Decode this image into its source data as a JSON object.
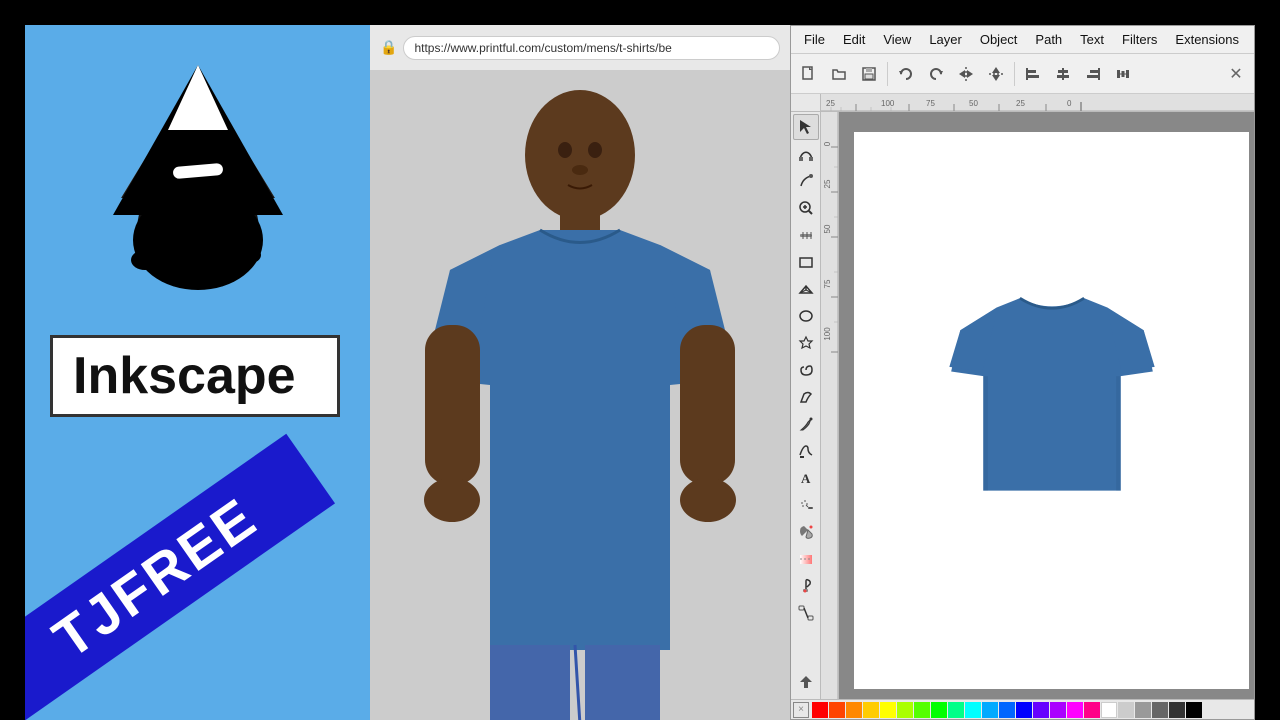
{
  "left_panel": {
    "bg_color": "#5aace8",
    "logo_alt": "Inkscape mountain logo",
    "title": "Inkscape",
    "banner_text": "TJFREE",
    "banner_bg": "#1a1acc"
  },
  "browser": {
    "url": "https://www.printful.com/custom/mens/t-shirts/be",
    "lock_icon": "🔒"
  },
  "inkscape_app": {
    "menu_items": [
      "File",
      "Edit",
      "View",
      "Layer",
      "Object",
      "Path",
      "Text",
      "Filters",
      "Extensions"
    ],
    "tshirt_color": "#3a6fa8",
    "canvas_bg": "#ffffff"
  },
  "toolbar": {
    "undo_label": "Undo",
    "redo_label": "Redo"
  },
  "color_palette": [
    "#ff0000",
    "#ff6600",
    "#ffaa00",
    "#ffff00",
    "#aaff00",
    "#00ff00",
    "#00ffaa",
    "#00ffff",
    "#00aaff",
    "#0000ff",
    "#aa00ff",
    "#ff00ff",
    "#ff0088",
    "#ffffff",
    "#cccccc",
    "#999999",
    "#666666",
    "#333333",
    "#000000",
    "#884400",
    "#884488",
    "#448844"
  ]
}
